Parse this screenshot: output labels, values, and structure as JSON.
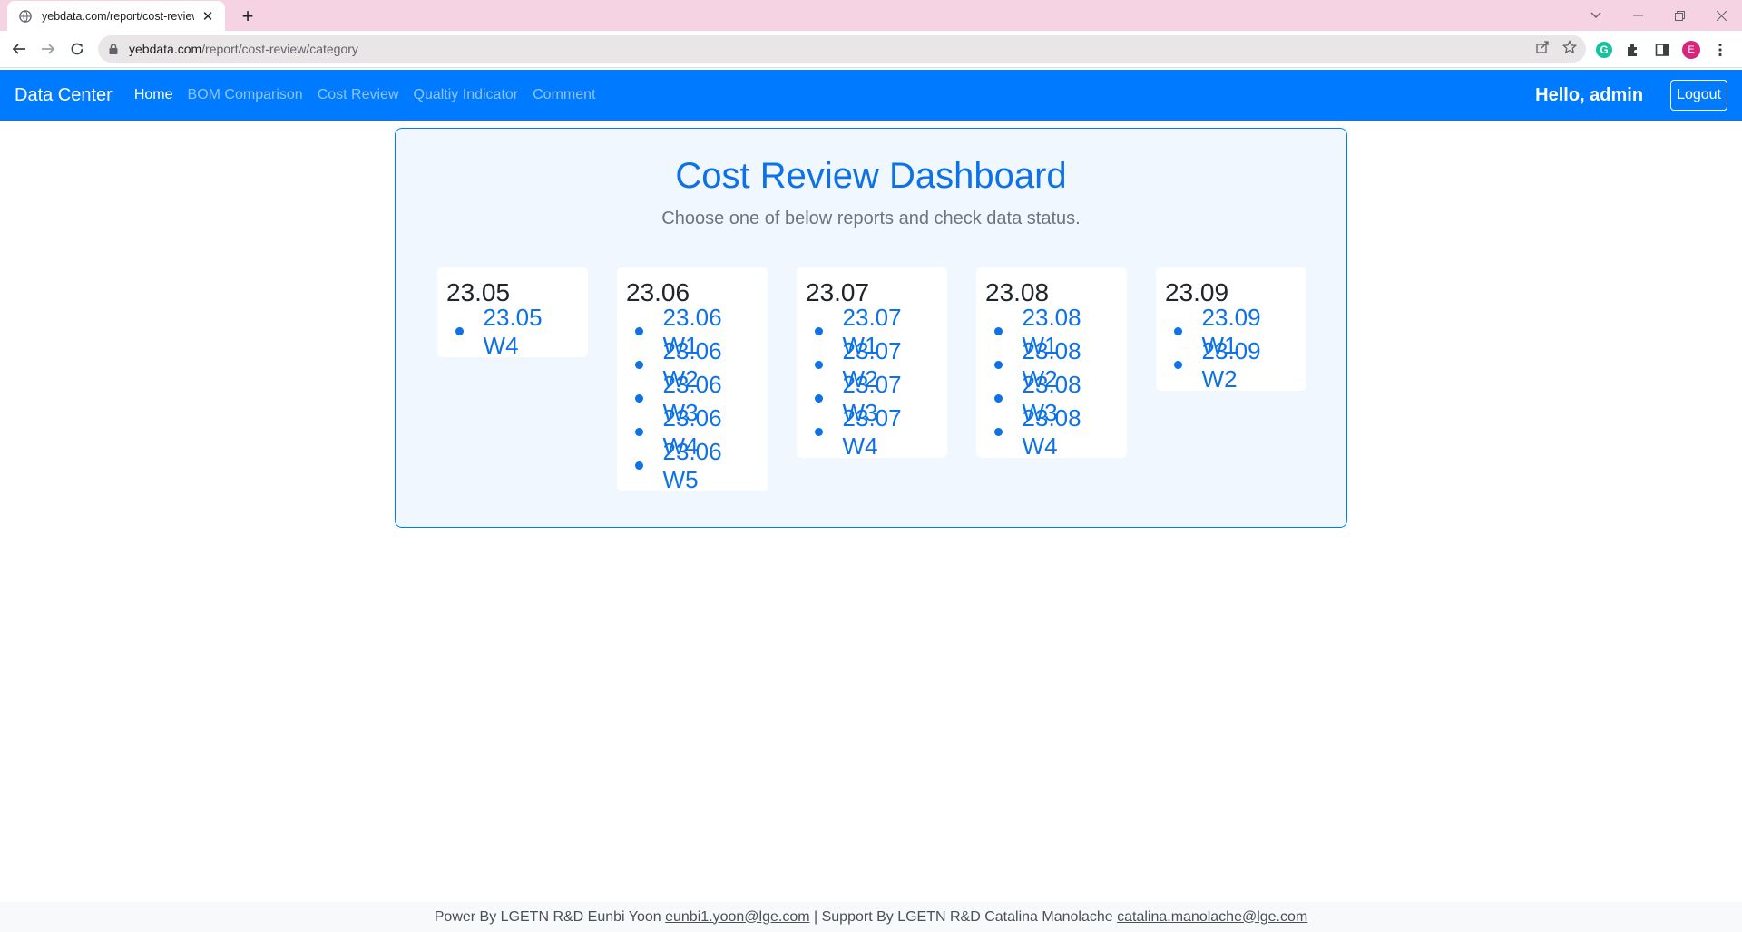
{
  "browser": {
    "tab_title": "yebdata.com/report/cost-review",
    "url_host": "yebdata.com",
    "url_path": "/report/cost-review/category",
    "profile_initial": "E"
  },
  "navbar": {
    "brand": "Data Center",
    "links": [
      "Home",
      "BOM Comparison",
      "Cost Review",
      "Qualtiy Indicator",
      "Comment"
    ],
    "active_index": 0,
    "greeting": "Hello, admin",
    "logout_label": "Logout"
  },
  "dashboard": {
    "title": "Cost Review Dashboard",
    "subtitle": "Choose one of below reports and check data status.",
    "categories": [
      {
        "title": "23.05",
        "reports": [
          "23.05 W4"
        ]
      },
      {
        "title": "23.06",
        "reports": [
          "23.06 W1",
          "23.06 W2",
          "23.06 W3",
          "23.06 W4",
          "23.06 W5"
        ]
      },
      {
        "title": "23.07",
        "reports": [
          "23.07 W1",
          "23.07 W2",
          "23.07 W3",
          "23.07 W4"
        ]
      },
      {
        "title": "23.08",
        "reports": [
          "23.08 W1",
          "23.08 W2",
          "23.08 W3",
          "23.08 W4"
        ]
      },
      {
        "title": "23.09",
        "reports": [
          "23.09 W1",
          "23.09 W2"
        ]
      }
    ]
  },
  "footer": {
    "text1": "Power By LGETN R&D Eunbi Yoon ",
    "email1": "eunbi1.yoon@lge.com",
    "text2": " | Support By LGETN R&D Catalina Manolache ",
    "email2": "catalina.manolache@lge.com"
  },
  "colors": {
    "primary": "#007bff",
    "link": "#0d72e8",
    "panel_bg": "#f0f7ff",
    "tabstrip": "#f6d3e2"
  }
}
